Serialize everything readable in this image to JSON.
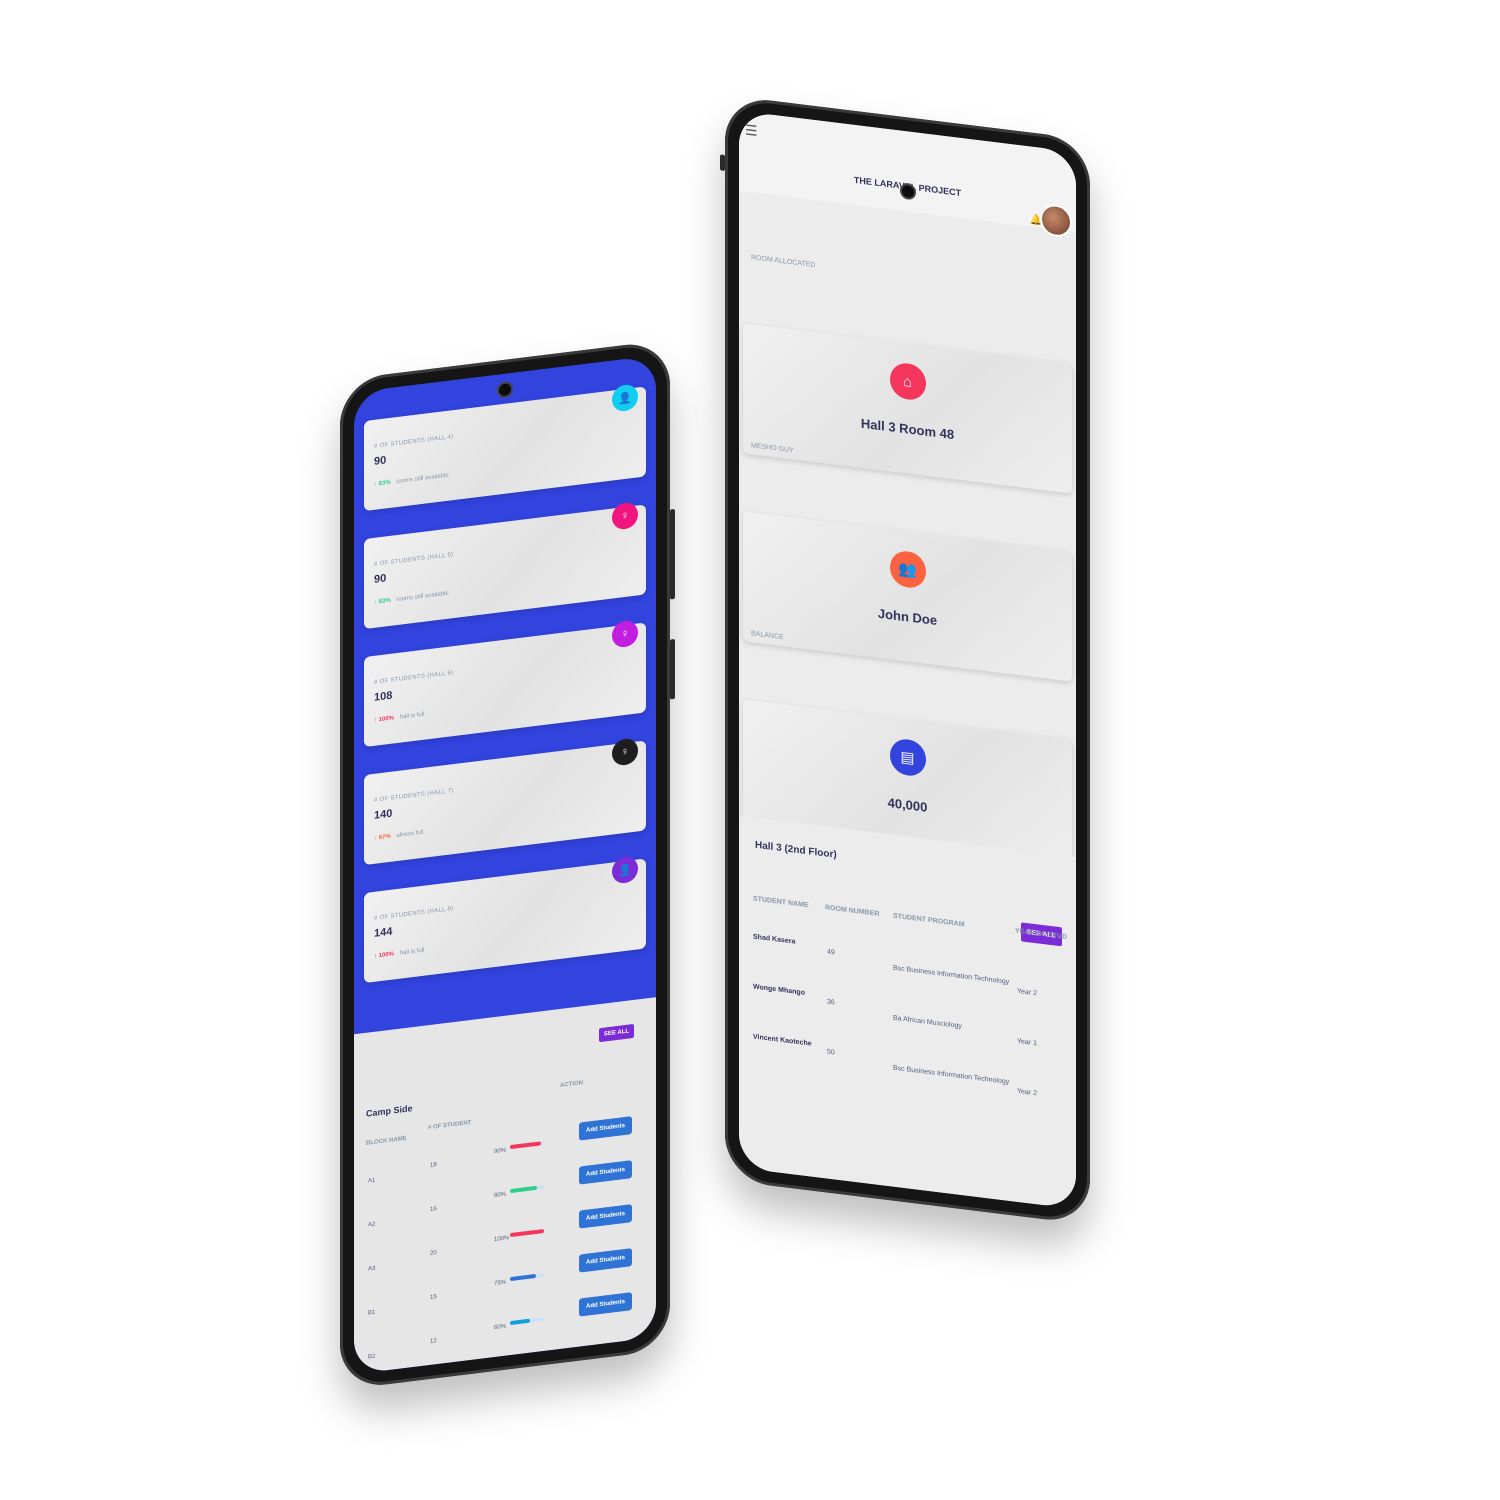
{
  "left_phone": {
    "stat_cards": [
      {
        "label": "# of students (Hall 4)",
        "value": "90",
        "pct": "83%",
        "note": "rooms still available",
        "trend": "up",
        "pct_color": "#2dce89",
        "icon": "user-icon",
        "icon_color": "#11cdef"
      },
      {
        "label": "# of students (Hall 5)",
        "value": "90",
        "pct": "83%",
        "note": "rooms still available",
        "trend": "up",
        "pct_color": "#2dce89",
        "icon": "female-icon",
        "icon_color": "#f3157f"
      },
      {
        "label": "# of students (Hall 6)",
        "value": "108",
        "pct": "100%",
        "note": "hall is full",
        "trend": "up",
        "pct_color": "#f5365c",
        "icon": "female-icon",
        "icon_color": "#c21ee0"
      },
      {
        "label": "# of students (Hall 7)",
        "value": "140",
        "pct": "97%",
        "note": "almost full",
        "trend": "up",
        "pct_color": "#fb6340",
        "icon": "female-icon",
        "icon_color": "#1e1e1e"
      },
      {
        "label": "# of students (Hall 8)",
        "value": "144",
        "pct": "100%",
        "note": "hall is full",
        "trend": "up",
        "pct_color": "#f5365c",
        "icon": "user-icon",
        "icon_color": "#7b2cd6"
      }
    ],
    "table": {
      "see_all": "SEE ALL",
      "title": "Camp Side",
      "headers": {
        "block": "Block name",
        "students": "# of student",
        "action": "Action"
      },
      "rows": [
        {
          "block": "A1",
          "students": "18",
          "pct_label": "90%",
          "pct": 0.9,
          "color": "#f5365c",
          "action": "Add Students"
        },
        {
          "block": "A2",
          "students": "16",
          "pct_label": "80%",
          "pct": 0.8,
          "color": "#2dce89",
          "action": "Add Students"
        },
        {
          "block": "A3",
          "students": "20",
          "pct_label": "100%",
          "pct": 1.0,
          "color": "#f5365c",
          "action": "Add Students"
        },
        {
          "block": "B1",
          "students": "15",
          "pct_label": "75%",
          "pct": 0.75,
          "color": "#2f73d6",
          "action": "Add Students"
        },
        {
          "block": "B2",
          "students": "12",
          "pct_label": "60%",
          "pct": 0.6,
          "color": "#11a0db",
          "action": "Add Students"
        }
      ]
    }
  },
  "right_phone": {
    "brand": "THE LARAVEL PROJECT",
    "menu_icon": "hamburger-icon",
    "bell_icon": "bell-icon",
    "cards": [
      {
        "label": "ROOM ALLOCATED",
        "value": "Hall 3 Room 48",
        "icon": "home-icon",
        "icon_color": "#f5365c"
      },
      {
        "label": "MESHO GUY",
        "value": "John Doe",
        "icon": "users-icon",
        "icon_color": "#fb6340"
      },
      {
        "label": "BALANCE",
        "value": "40,000",
        "icon": "credit-card-icon",
        "icon_color": "#3243de"
      }
    ],
    "hall": {
      "title": "Hall 3 (2nd Floor)",
      "see_all": "SEE ALL",
      "headers": {
        "name": "Student name",
        "room": "Room number",
        "program": "Student program",
        "year": "Year of stud"
      },
      "rows": [
        {
          "name": "Shad Kasera",
          "room": "49",
          "program": "Bsc Business Information Technology",
          "year": "Year 2"
        },
        {
          "name": "Wonge Mhango",
          "room": "36",
          "program": "Ba African Musciology",
          "year": "Year 1"
        },
        {
          "name": "Vincent Kaoteche",
          "room": "50",
          "program": "Bsc Business Information Technology",
          "year": "Year 2"
        }
      ]
    }
  }
}
